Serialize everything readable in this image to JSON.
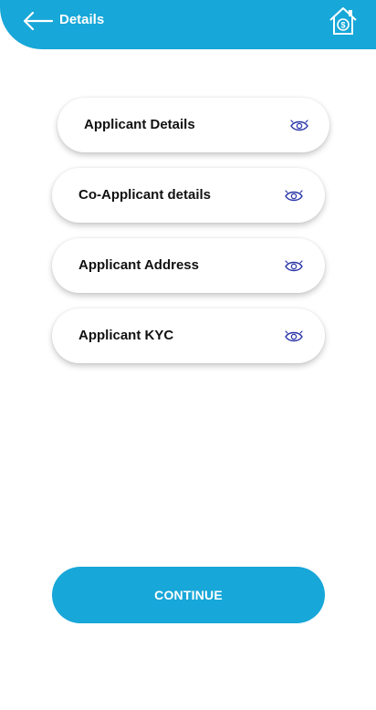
{
  "header": {
    "title": "Details",
    "back_icon": "arrow-left-icon",
    "home_icon": "home-dollar-icon",
    "color": "#17a7d8"
  },
  "sections": [
    {
      "label": "Applicant Details",
      "icon": "eye-icon"
    },
    {
      "label": "Co-Applicant details",
      "icon": "eye-icon"
    },
    {
      "label": "Applicant Address",
      "icon": "eye-icon"
    },
    {
      "label": "Applicant KYC",
      "icon": "eye-icon"
    }
  ],
  "continue_button": {
    "label": "CONTINUE",
    "color": "#17a7d8"
  },
  "colors": {
    "icon": "#2a35a8",
    "text": "#111111"
  }
}
